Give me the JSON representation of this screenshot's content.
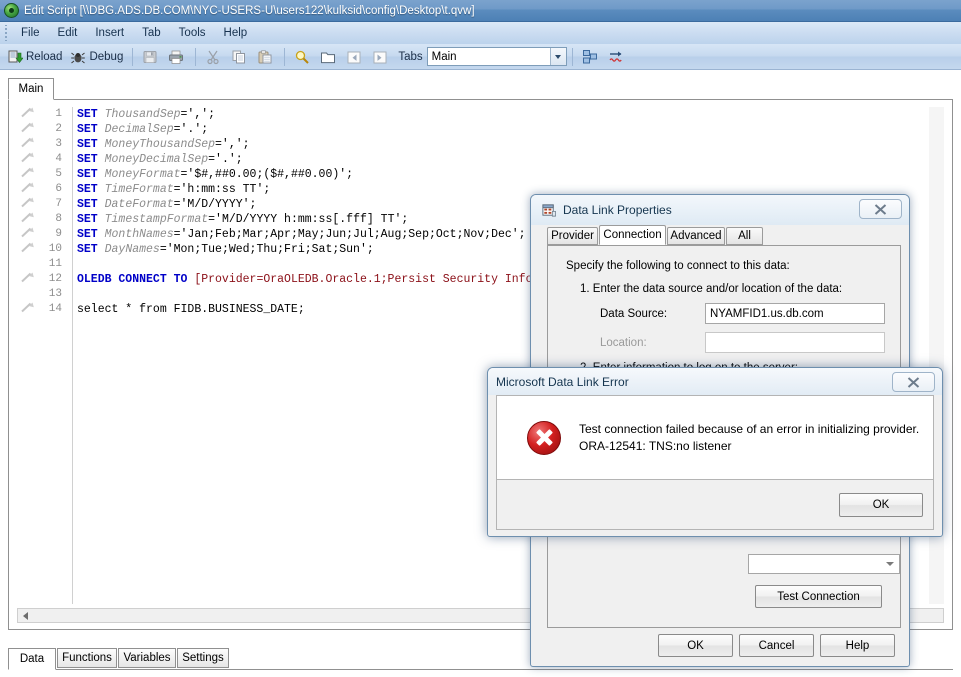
{
  "window": {
    "title": "Edit Script [\\\\DBG.ADS.DB.COM\\NYC-USERS-U\\users122\\kulksid\\config\\Desktop\\t.qvw]",
    "app_icon": "qlikview-icon"
  },
  "menubar": {
    "items": [
      "File",
      "Edit",
      "Insert",
      "Tab",
      "Tools",
      "Help"
    ]
  },
  "toolbar": {
    "reload_label": "Reload",
    "debug_label": "Debug",
    "tabs_label": "Tabs",
    "tab_value": "Main",
    "icons": [
      "reload-icon",
      "debug-icon",
      "save-icon",
      "print-icon",
      "cut-icon",
      "copy-icon",
      "paste-icon",
      "find-icon",
      "open-folder-icon",
      "previous-tab-icon",
      "next-tab-icon",
      "chevron-down-icon",
      "tab-organize-icon",
      "syntax-check-icon"
    ]
  },
  "script_tabs": {
    "active": "Main",
    "items": [
      "Main"
    ]
  },
  "editor": {
    "lines": [
      {
        "n": "1",
        "tokens": [
          {
            "t": "kw",
            "v": "SET "
          },
          {
            "t": "var",
            "v": "ThousandSep"
          },
          {
            "t": "lit",
            "v": "=',';"
          }
        ]
      },
      {
        "n": "2",
        "tokens": [
          {
            "t": "kw",
            "v": "SET "
          },
          {
            "t": "var",
            "v": "DecimalSep"
          },
          {
            "t": "lit",
            "v": "='.';"
          }
        ]
      },
      {
        "n": "3",
        "tokens": [
          {
            "t": "kw",
            "v": "SET "
          },
          {
            "t": "var",
            "v": "MoneyThousandSep"
          },
          {
            "t": "lit",
            "v": "=',';"
          }
        ]
      },
      {
        "n": "4",
        "tokens": [
          {
            "t": "kw",
            "v": "SET "
          },
          {
            "t": "var",
            "v": "MoneyDecimalSep"
          },
          {
            "t": "lit",
            "v": "='.';"
          }
        ]
      },
      {
        "n": "5",
        "tokens": [
          {
            "t": "kw",
            "v": "SET "
          },
          {
            "t": "var",
            "v": "MoneyFormat"
          },
          {
            "t": "lit",
            "v": "='$#,##0.00;($#,##0.00)';"
          }
        ]
      },
      {
        "n": "6",
        "tokens": [
          {
            "t": "kw",
            "v": "SET "
          },
          {
            "t": "var",
            "v": "TimeFormat"
          },
          {
            "t": "lit",
            "v": "='h:mm:ss TT';"
          }
        ]
      },
      {
        "n": "7",
        "tokens": [
          {
            "t": "kw",
            "v": "SET "
          },
          {
            "t": "var",
            "v": "DateFormat"
          },
          {
            "t": "lit",
            "v": "='M/D/YYYY';"
          }
        ]
      },
      {
        "n": "8",
        "tokens": [
          {
            "t": "kw",
            "v": "SET "
          },
          {
            "t": "var",
            "v": "TimestampFormat"
          },
          {
            "t": "lit",
            "v": "='M/D/YYYY h:mm:ss[.fff] TT';"
          }
        ]
      },
      {
        "n": "9",
        "tokens": [
          {
            "t": "kw",
            "v": "SET "
          },
          {
            "t": "var",
            "v": "MonthNames"
          },
          {
            "t": "lit",
            "v": "='Jan;Feb;Mar;Apr;May;Jun;Jul;Aug;Sep;Oct;Nov;Dec';"
          }
        ]
      },
      {
        "n": "10",
        "tokens": [
          {
            "t": "kw",
            "v": "SET "
          },
          {
            "t": "var",
            "v": "DayNames"
          },
          {
            "t": "lit",
            "v": "='Mon;Tue;Wed;Thu;Fri;Sat;Sun';"
          }
        ]
      },
      {
        "n": "11",
        "tokens": []
      },
      {
        "n": "12",
        "tokens": [
          {
            "t": "kw",
            "v": "OLEDB CONNECT TO "
          },
          {
            "t": "maroon",
            "v": "[Provider=OraOLEDB.Oracle.1;Persist Security Info=True;Extended Pro"
          }
        ]
      },
      {
        "n": "13",
        "tokens": []
      },
      {
        "n": "14",
        "tokens": [
          {
            "t": "plain",
            "v": "select * from FIDB.BUSINESS_DATE;"
          }
        ]
      }
    ],
    "hscroll_left_icon": "scroll-left-arrow"
  },
  "bottom_tabs": {
    "active": "Data",
    "items": [
      "Data",
      "Functions",
      "Variables",
      "Settings"
    ]
  },
  "data_link_dialog": {
    "title": "Data Link Properties",
    "icon": "data-link-icon",
    "close_icon": "close-icon",
    "tabs": [
      "Provider",
      "Connection",
      "Advanced",
      "All"
    ],
    "active_tab": "Connection",
    "intro": "Specify the following to connect to this data:",
    "step1": "1. Enter the data source and/or location of the data:",
    "data_source_label": "Data Source:",
    "data_source_value": "NYAMFID1.us.db.com",
    "location_label": "Location:",
    "location_value": "",
    "step2": "2. Enter information to log on to the server:",
    "test_connection_label": "Test Connection",
    "ok_label": "OK",
    "cancel_label": "Cancel",
    "help_label": "Help"
  },
  "error_dialog": {
    "title": "Microsoft Data Link Error",
    "close_icon": "close-icon",
    "error_icon": "error-circle-icon",
    "message_line1": "Test connection failed because of an error in initializing provider.",
    "message_line2": "ORA-12541: TNS:no listener",
    "ok_label": "OK"
  },
  "colors": {
    "titlebar_accent": "#5b8cbe",
    "keyword": "#0000c8",
    "variable": "#8c8c8c",
    "connect_string": "#8b0f17",
    "error_red": "#d32020"
  }
}
